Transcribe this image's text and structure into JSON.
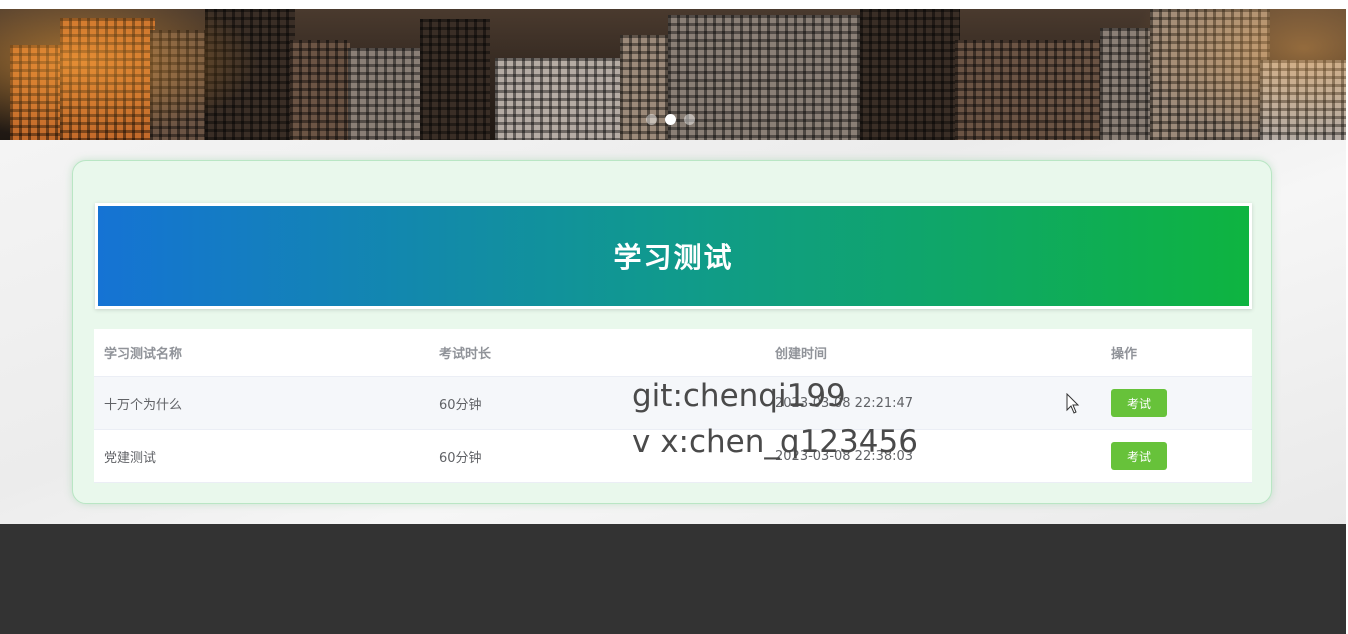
{
  "banner": {
    "slide_count": 3,
    "active_slide": 2
  },
  "exam_section": {
    "title": "学习测试",
    "table": {
      "headers": {
        "name": "学习测试名称",
        "duration": "考试时长",
        "created": "创建时间",
        "action": "操作"
      },
      "rows": [
        {
          "name": "十万个为什么",
          "duration": "60分钟",
          "created": "2023-03-08 22:21:47",
          "action": "考试"
        },
        {
          "name": "党建测试",
          "duration": "60分钟",
          "created": "2023-03-08 22:38:03",
          "action": "考试"
        }
      ]
    }
  },
  "watermark": {
    "line1": "git:chenqi199",
    "line2": "v x:chen_q123456"
  },
  "colors": {
    "title_gradient_start": "#1573d4",
    "title_gradient_end": "#0eb440",
    "button": "#67c23a",
    "footer": "#333333",
    "panel_bg": "#e9f8ec"
  }
}
